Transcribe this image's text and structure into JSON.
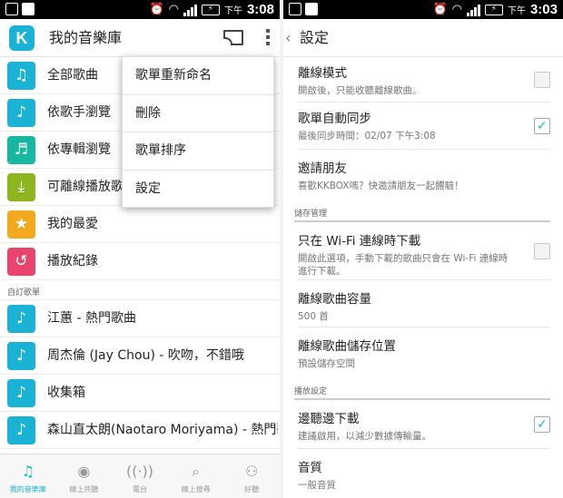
{
  "status_bar": {
    "ampm": "下午",
    "time": "3:08",
    "time_right": "3:03"
  },
  "library": {
    "title": "我的音樂庫",
    "items": [
      {
        "label": "全部歌曲",
        "icon": "music-list-icon",
        "color": "#1ab3d6"
      },
      {
        "label": "依歌手瀏覽",
        "icon": "artist-icon",
        "color": "#1ab3d6"
      },
      {
        "label": "依專輯瀏覽",
        "icon": "album-icon",
        "color": "#18b8a0"
      },
      {
        "label": "可離線播放歌曲",
        "icon": "download-icon",
        "color": "#8cb51e"
      },
      {
        "label": "我的最愛",
        "icon": "star-icon",
        "color": "#f2a91d"
      },
      {
        "label": "播放紀錄",
        "icon": "history-icon",
        "color": "#e8446e"
      }
    ],
    "custom_section": "自訂歌單",
    "playlists": [
      {
        "label": "江蕙 - 熱門歌曲"
      },
      {
        "label": "周杰倫 (Jay Chou) - 吹吻，不錯哦"
      },
      {
        "label": "收集箱"
      },
      {
        "label": "森山直太朗(Naotaro Moriyama) - 熱門歌曲"
      }
    ],
    "playlist_color": "#1ab3d6"
  },
  "menu": {
    "items": [
      "歌單重新命名",
      "刪除",
      "歌單排序",
      "設定"
    ]
  },
  "bottom_nav": {
    "items": [
      {
        "label": "我的音樂庫",
        "icon": "library-icon"
      },
      {
        "label": "線上共聽",
        "icon": "listen-together-icon"
      },
      {
        "label": "電台",
        "icon": "radio-icon"
      },
      {
        "label": "線上搜尋",
        "icon": "search-icon"
      },
      {
        "label": "好聽",
        "icon": "people-icon"
      }
    ]
  },
  "settings": {
    "title": "設定",
    "offline_mode": {
      "title": "離線模式",
      "subtitle": "開啟後，只能收聽離線歌曲。",
      "checked": false
    },
    "auto_sync": {
      "title": "歌單自動同步",
      "subtitle": "最後同步時間：02/07 下午3:08",
      "checked": true
    },
    "invite": {
      "title": "邀請朋友",
      "subtitle": "喜歡KKBOX嗎？快邀請朋友一起體驗！"
    },
    "storage_section": "儲存管理",
    "wifi_only": {
      "title": "只在 Wi-Fi 連線時下載",
      "subtitle": "開啟此選項，手動下載的歌曲只會在 Wi-Fi 連線時進行下載。",
      "checked": false
    },
    "capacity": {
      "title": "離線歌曲容量",
      "subtitle": "500 首"
    },
    "location": {
      "title": "離線歌曲儲存位置",
      "subtitle": "預設儲存空間"
    },
    "playback_section": "播放設定",
    "stream_download": {
      "title": "邊聽邊下載",
      "subtitle": "建議啟用，以減少數據傳輸量。",
      "checked": true
    },
    "quality": {
      "title": "音質",
      "subtitle": "一般音質"
    }
  }
}
